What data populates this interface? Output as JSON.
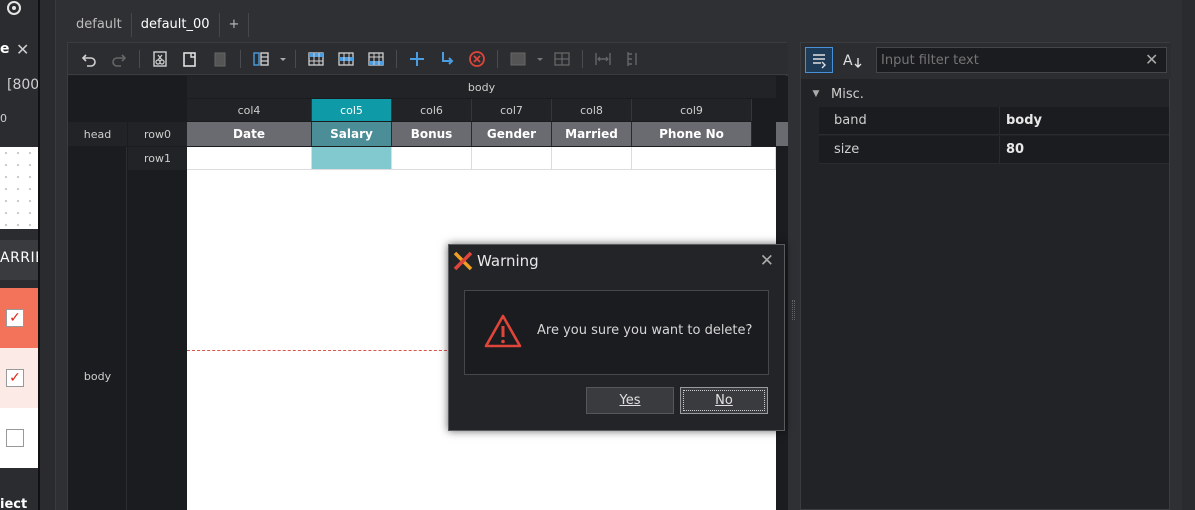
{
  "left_panel": {
    "tab_text": "e",
    "size_text": "[800:",
    "ruler_text": "0",
    "column_header": "ARRIE",
    "bottom_text": "iect"
  },
  "tabs": [
    {
      "label": "default"
    },
    {
      "label": "default_00"
    },
    {
      "label": "+"
    }
  ],
  "grid": {
    "band_header": "body",
    "columns": [
      "col4",
      "col5",
      "col6",
      "col7",
      "col8",
      "col9"
    ],
    "head_label": "head",
    "row0_label": "row0",
    "row1_label": "row1",
    "body_label": "body",
    "head_cells": [
      "Date",
      "Salary",
      "Bonus",
      "Gender",
      "Married",
      "Phone No"
    ]
  },
  "properties": {
    "filter_placeholder": "Input filter text",
    "filter_clear": "✕",
    "group": "Misc.",
    "rows": [
      {
        "key": "band",
        "value": "body"
      },
      {
        "key": "size",
        "value": "80"
      }
    ]
  },
  "dialog": {
    "title": "Warning",
    "close": "✕",
    "message": "Are you sure you want to delete?",
    "yes_label": "Yes",
    "no_label": "No"
  },
  "colors": {
    "accent": "#0e9aa7",
    "warning_icon": "#e0453a",
    "selected_row": "#f3725a"
  }
}
